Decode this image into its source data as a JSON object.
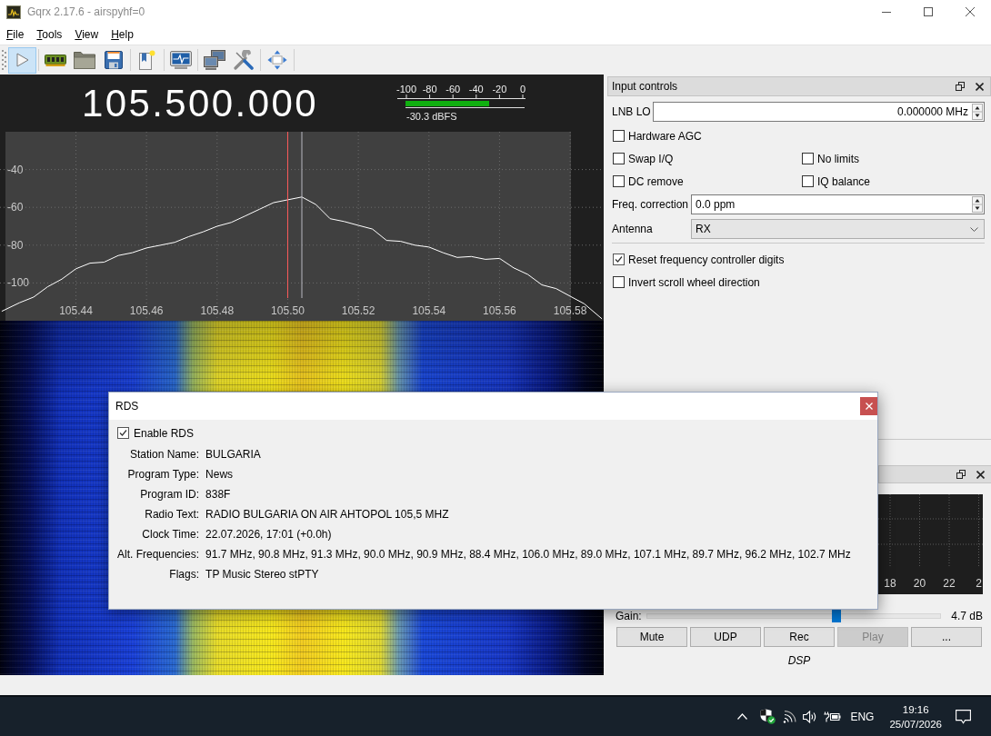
{
  "window": {
    "title": "Gqrx 2.17.6 - airspyhf=0"
  },
  "menu": [
    "File",
    "Tools",
    "View",
    "Help"
  ],
  "toolbar": {
    "play_button": {
      "checked": true
    }
  },
  "frequency_display": {
    "value": "105.500.000"
  },
  "signal_meter": {
    "scale": [
      "-100",
      "-80",
      "-60",
      "-40",
      "-20",
      "0"
    ],
    "level": 0.7,
    "reading": "-30.3 dBFS"
  },
  "spectrum": {
    "chart_data": {
      "type": "line",
      "x": [
        105.419,
        105.424,
        105.428,
        105.432,
        105.436,
        105.44,
        105.444,
        105.448,
        105.452,
        105.456,
        105.46,
        105.464,
        105.468,
        105.472,
        105.476,
        105.48,
        105.484,
        105.488,
        105.492,
        105.496,
        105.5,
        105.504,
        105.508,
        105.512,
        105.516,
        105.52,
        105.524,
        105.528,
        105.532,
        105.536,
        105.54,
        105.544,
        105.548,
        105.552,
        105.556,
        105.56,
        105.564,
        105.568,
        105.572,
        105.576,
        105.58,
        105.584,
        105.589
      ],
      "series": [
        {
          "color": "#ffffff",
          "values": [
            -115,
            -110.5,
            -107.5,
            -102,
            -98,
            -92.5,
            -89.5,
            -89,
            -85.5,
            -84,
            -81.5,
            -80,
            -78.5,
            -75.5,
            -73,
            -70,
            -68,
            -64.5,
            -61,
            -57.5,
            -56,
            -54.5,
            -58.5,
            -66,
            -67.5,
            -69.5,
            -71.5,
            -77.5,
            -78,
            -80,
            -81,
            -84,
            -86.5,
            -86,
            -87.5,
            -87,
            -92,
            -95.5,
            -101,
            -103,
            -107,
            -111,
            -119
          ]
        }
      ],
      "xlim": [
        105.4185,
        105.5895
      ],
      "ylim": [
        -120,
        -20
      ],
      "xticks": [
        105.44,
        105.46,
        105.48,
        {
          "value": 105.5,
          "label": "105.50"
        },
        105.52,
        105.54,
        105.56,
        105.58
      ],
      "yticks": [
        -40,
        -60,
        -80,
        -100
      ],
      "grid": true,
      "ref_lines": [
        {
          "axis": "x",
          "value": 105.5,
          "color": "#ff5a5a"
        },
        {
          "axis": "x",
          "value": 105.504,
          "color": "#b8b8c0"
        }
      ]
    }
  },
  "input_controls": {
    "title": "Input controls",
    "lnb_lo": {
      "label": "LNB LO",
      "value": "0.000000 MHz"
    },
    "option_rows": [
      [
        {
          "label": "Hardware AGC",
          "checked": false
        }
      ],
      [
        {
          "label": "Swap I/Q",
          "checked": false
        },
        {
          "label": "No limits",
          "checked": false
        }
      ],
      [
        {
          "label": "DC remove",
          "checked": false
        },
        {
          "label": "IQ balance",
          "checked": false
        }
      ]
    ],
    "freq_correction": {
      "label": "Freq. correction",
      "value": "0.0 ppm"
    },
    "antenna": {
      "label": "Antenna",
      "value": "RX"
    },
    "settings": [
      {
        "label": "Reset frequency controller digits",
        "checked": true
      },
      {
        "label": "Invert scroll wheel direction",
        "checked": false
      }
    ]
  },
  "audio_panel": {
    "plot_labels": [
      "18",
      "20",
      "22",
      "2"
    ],
    "gain": {
      "label": "Gain:",
      "level": 0.645,
      "reading": "4.7 dB"
    },
    "buttons": [
      {
        "label": "Mute",
        "disabled": false
      },
      {
        "label": "UDP",
        "disabled": false
      },
      {
        "label": "Rec",
        "disabled": false
      },
      {
        "label": "Play",
        "disabled": true
      },
      {
        "label": "...",
        "disabled": false
      }
    ],
    "footer_label": "DSP"
  },
  "rds_dialog": {
    "title": "RDS",
    "enable_rds": {
      "label": "Enable RDS",
      "checked": true
    },
    "fields": [
      {
        "label": "Station Name:",
        "value": "BULGARIA"
      },
      {
        "label": "Program Type:",
        "value": "News"
      },
      {
        "label": "Program ID:",
        "value": "838F"
      },
      {
        "label": "Radio Text:",
        "value": "RADIO BULGARIA ON AIR AHTOPOL 105,5 MHZ"
      },
      {
        "label": "Clock Time:",
        "value": "22.07.2026, 17:01 (+0.0h)"
      },
      {
        "label": "Alt. Frequencies:",
        "value": "91.7 MHz, 90.8 MHz, 91.3 MHz, 90.0 MHz, 90.9 MHz, 88.4 MHz, 106.0 MHz, 89.0 MHz, 107.1 MHz, 89.7 MHz, 96.2 MHz, 102.7 MHz"
      },
      {
        "label": "Flags:",
        "value": "TP Music Stereo stPTY"
      }
    ]
  },
  "taskbar": {
    "language": "ENG",
    "time": "19:16",
    "date": "25/07/2026"
  }
}
